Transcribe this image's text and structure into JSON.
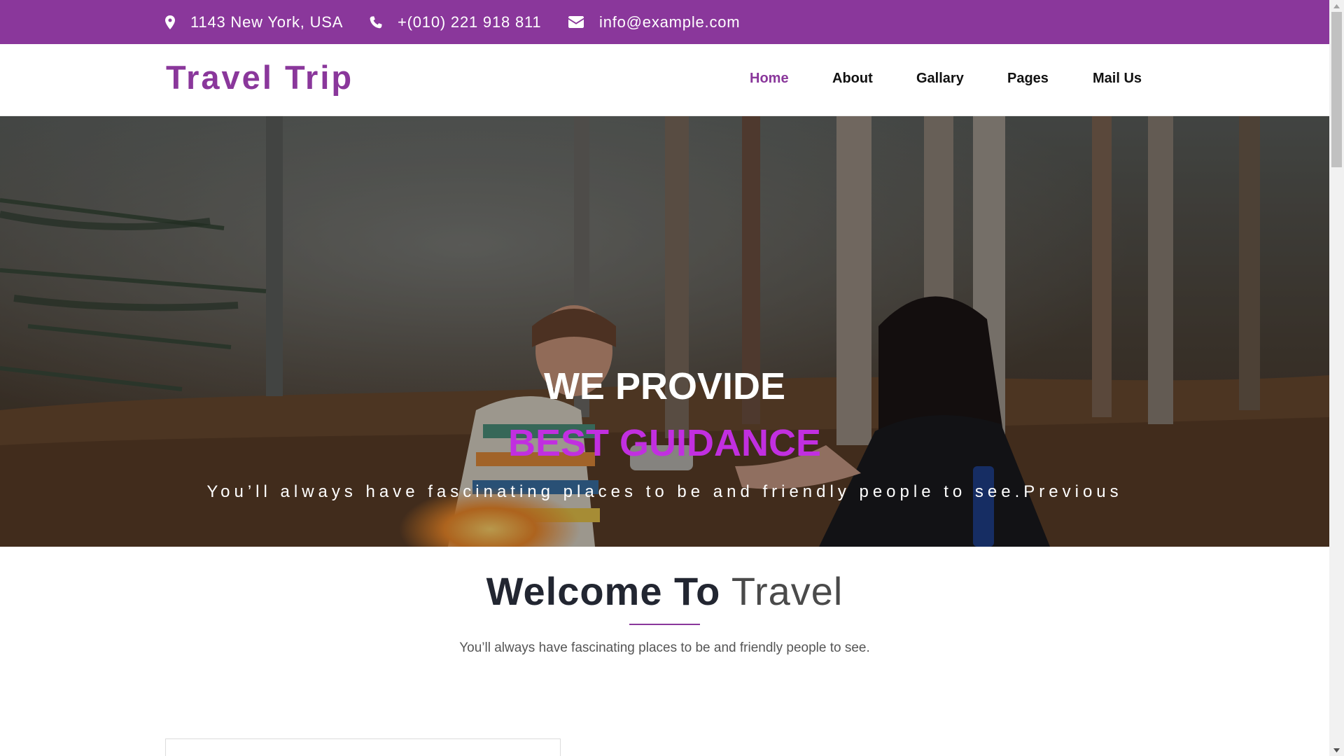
{
  "colors": {
    "brand": "#8a379b",
    "accent": "#c12fe0",
    "heading": "#222631",
    "text": "#555555"
  },
  "topbar": {
    "address": "1143 New York, USA",
    "address_icon": "map-marker-icon",
    "phone": "+(010) 221 918 811",
    "phone_icon": "phone-icon",
    "email": "info@example.com",
    "email_icon": "envelope-icon"
  },
  "navbar": {
    "brand": "Travel Trip",
    "links": [
      {
        "label": "Home",
        "active": true
      },
      {
        "label": "About",
        "active": false
      },
      {
        "label": "Gallary",
        "active": false
      },
      {
        "label": "Pages",
        "active": false
      },
      {
        "label": "Mail Us",
        "active": false
      }
    ]
  },
  "hero": {
    "title_line1": "WE PROVIDE",
    "title_line2": "BEST GUIDANCE",
    "subtitle": "You’ll always have fascinating places to be and friendly people to see.Previous"
  },
  "welcome": {
    "title_strong": "Welcome To",
    "title_light": "Travel",
    "subtitle": "You’ll always have fascinating places to be and friendly people to see."
  }
}
